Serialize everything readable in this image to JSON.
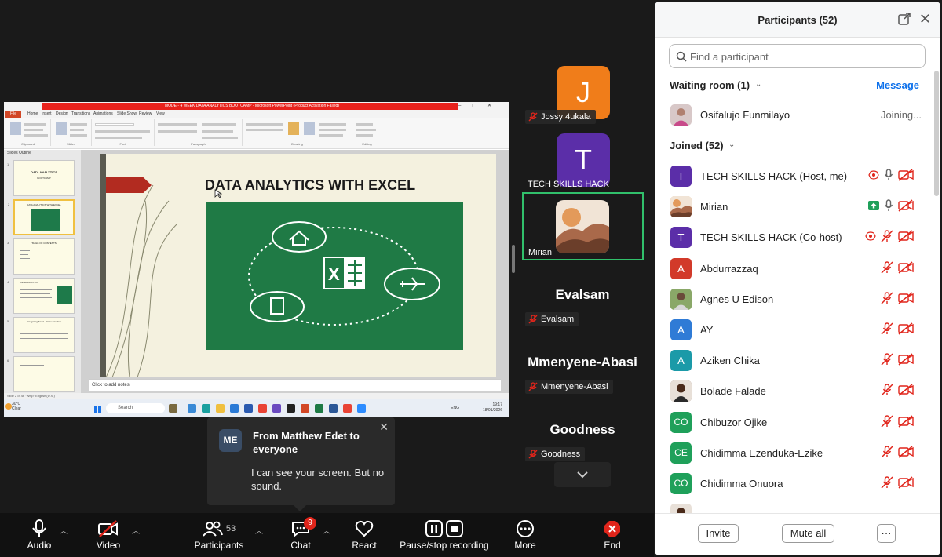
{
  "shared_screen": {
    "window_title": "MODE - 4 WEEK DATA ANALYTICS BOOTCAMP - Microsoft PowerPoint (Product Activation Failed)",
    "tabs": [
      "File",
      "Home",
      "Insert",
      "Design",
      "Transitions",
      "Animations",
      "Slide Show",
      "Review",
      "View"
    ],
    "ribbon_groups": [
      "Clipboard",
      "Slides",
      "Font",
      "Paragraph",
      "Drawing",
      "Editing"
    ],
    "side_tabs": "Slides  Outline",
    "thumbnails": [
      {
        "n": "1",
        "title": "DATA ANALYTICS",
        "sub": "BOOTCAMP"
      },
      {
        "n": "2",
        "title": "DATA ANALYTICS WITH EXCEL",
        "sub": ""
      },
      {
        "n": "3",
        "title": "TABLE OF CONTENTS",
        "sub": ""
      },
      {
        "n": "4",
        "title": "INTRODUCTION",
        "sub": ""
      },
      {
        "n": "5",
        "title": "Navigating Excel – Data Interface",
        "sub": ""
      },
      {
        "n": "6",
        "title": "",
        "sub": ""
      }
    ],
    "slide_title": "DATA ANALYTICS WITH EXCEL",
    "notes_placeholder": "Click to add notes",
    "status_bar": "Slide 2 of 46   \"Wisp\"   English (U.S.)",
    "taskbar": {
      "weather_temp": "30°C",
      "weather_desc": "Clear",
      "search": "Search",
      "lang": "ENG",
      "time": "19:17",
      "date": "18/01/2026"
    }
  },
  "video_tiles": [
    {
      "initial": "J",
      "name": "Jossy 4ukala",
      "color": "#f07d1a",
      "muted": true
    },
    {
      "initial": "T",
      "name": "TECH SKILLS HACK",
      "color": "#5b2ea8",
      "muted": false
    },
    {
      "name": "Mirian",
      "muted": false
    },
    {
      "big_name": "Evalsam",
      "name": "Evalsam",
      "muted": true
    },
    {
      "big_name": "Mmenyene-Abasi",
      "name": "Mmenyene-Abasi",
      "muted": true
    },
    {
      "big_name": "Goodness",
      "name": "Goodness",
      "muted": true
    }
  ],
  "chat_toast": {
    "initials": "ME",
    "from": "From Matthew Edet to everyone",
    "message": "I can see your screen. But no sound.",
    "close": "✕"
  },
  "toolbar": {
    "audio": "Audio",
    "video": "Video",
    "participants": "Participants",
    "participants_count": "53",
    "chat": "Chat",
    "chat_badge": "9",
    "react": "React",
    "recording": "Pause/stop recording",
    "more": "More",
    "end": "End"
  },
  "panel": {
    "title": "Participants (52)",
    "search_placeholder": "Find a participant",
    "waiting_room": "Waiting room (1)",
    "message": "Message",
    "waiting": [
      {
        "name": "Osifalujo Funmilayo",
        "status": "Joining..."
      }
    ],
    "joined": "Joined (52)",
    "participants": [
      {
        "initial": "T",
        "name": "TECH SKILLS HACK (Host, me)",
        "color": "#5b2ea8",
        "photo": false,
        "rec": true,
        "mic_on": true,
        "share": false
      },
      {
        "initial": "",
        "name": "Mirian",
        "color": "#e8b07a",
        "photo": true,
        "rec": false,
        "mic_on": true,
        "share": true
      },
      {
        "initial": "T",
        "name": "TECH SKILLS HACK (Co-host)",
        "color": "#5b2ea8",
        "photo": false,
        "rec": true,
        "mic_on": false,
        "share": false
      },
      {
        "initial": "A",
        "name": "Abdurrazzaq",
        "color": "#d23a2a",
        "photo": false,
        "rec": false,
        "mic_on": false,
        "share": false
      },
      {
        "initial": "",
        "name": "Agnes U Edison",
        "color": "#6a8a4a",
        "photo": true,
        "rec": false,
        "mic_on": false,
        "share": false
      },
      {
        "initial": "A",
        "name": "AY",
        "color": "#2f7bd6",
        "photo": false,
        "rec": false,
        "mic_on": false,
        "share": false
      },
      {
        "initial": "A",
        "name": "Aziken Chika",
        "color": "#1b9aa8",
        "photo": false,
        "rec": false,
        "mic_on": false,
        "share": false
      },
      {
        "initial": "",
        "name": "Bolade Falade",
        "color": "#7a5a4a",
        "photo": true,
        "rec": false,
        "mic_on": false,
        "share": false
      },
      {
        "initial": "CO",
        "name": "Chibuzor Ojike",
        "color": "#1fa05a",
        "photo": false,
        "rec": false,
        "mic_on": false,
        "share": false
      },
      {
        "initial": "CE",
        "name": "Chidimma Ezenduka-Ezike",
        "color": "#1fa05a",
        "photo": false,
        "rec": false,
        "mic_on": false,
        "share": false
      },
      {
        "initial": "CO",
        "name": "Chidimma Onuora",
        "color": "#1fa05a",
        "photo": false,
        "rec": false,
        "mic_on": false,
        "share": false
      }
    ],
    "invite": "Invite",
    "mute_all": "Mute all",
    "more": "···"
  }
}
